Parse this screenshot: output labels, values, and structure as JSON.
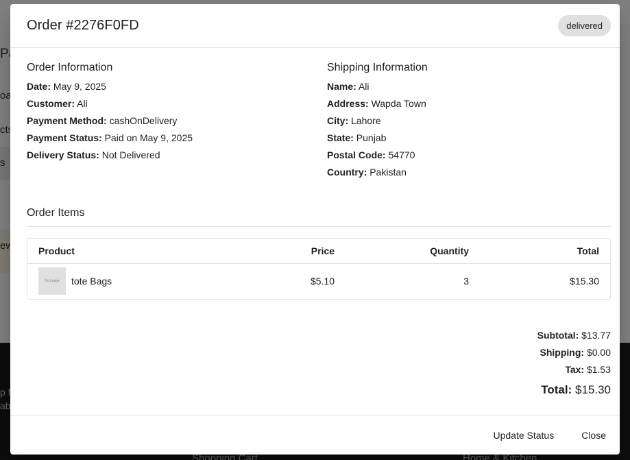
{
  "background": {
    "fragments": [
      "Pa",
      "oa",
      "cts",
      "s",
      "ew",
      "p f",
      "ab",
      "Shopping Cart",
      "Home & Kitchen"
    ]
  },
  "modal": {
    "title": "Order #2276F0FD",
    "status": "delivered",
    "order_info": {
      "heading": "Order Information",
      "date_label": "Date:",
      "date": "May 9, 2025",
      "customer_label": "Customer:",
      "customer": "Ali",
      "payment_method_label": "Payment Method:",
      "payment_method": "cashOnDelivery",
      "payment_status_label": "Payment Status:",
      "payment_status": "Paid on May 9, 2025",
      "delivery_status_label": "Delivery Status:",
      "delivery_status": "Not Delivered"
    },
    "shipping_info": {
      "heading": "Shipping Information",
      "name_label": "Name:",
      "name": "Ali",
      "address_label": "Address:",
      "address": "Wapda Town",
      "city_label": "City:",
      "city": "Lahore",
      "state_label": "State:",
      "state": "Punjab",
      "postal_label": "Postal Code:",
      "postal": "54770",
      "country_label": "Country:",
      "country": "Pakistan"
    },
    "items": {
      "heading": "Order Items",
      "columns": [
        "Product",
        "Price",
        "Quantity",
        "Total"
      ],
      "rows": [
        {
          "thumb": "No Image",
          "product": "tote Bags",
          "price": "$5.10",
          "quantity": "3",
          "total": "$15.30"
        }
      ]
    },
    "totals": {
      "subtotal_label": "Subtotal:",
      "subtotal": "$13.77",
      "shipping_label": "Shipping:",
      "shipping": "$0.00",
      "tax_label": "Tax:",
      "tax": "$1.53",
      "total_label": "Total:",
      "total": "$15.30"
    },
    "footer": {
      "update_status": "Update Status",
      "close": "Close"
    }
  }
}
